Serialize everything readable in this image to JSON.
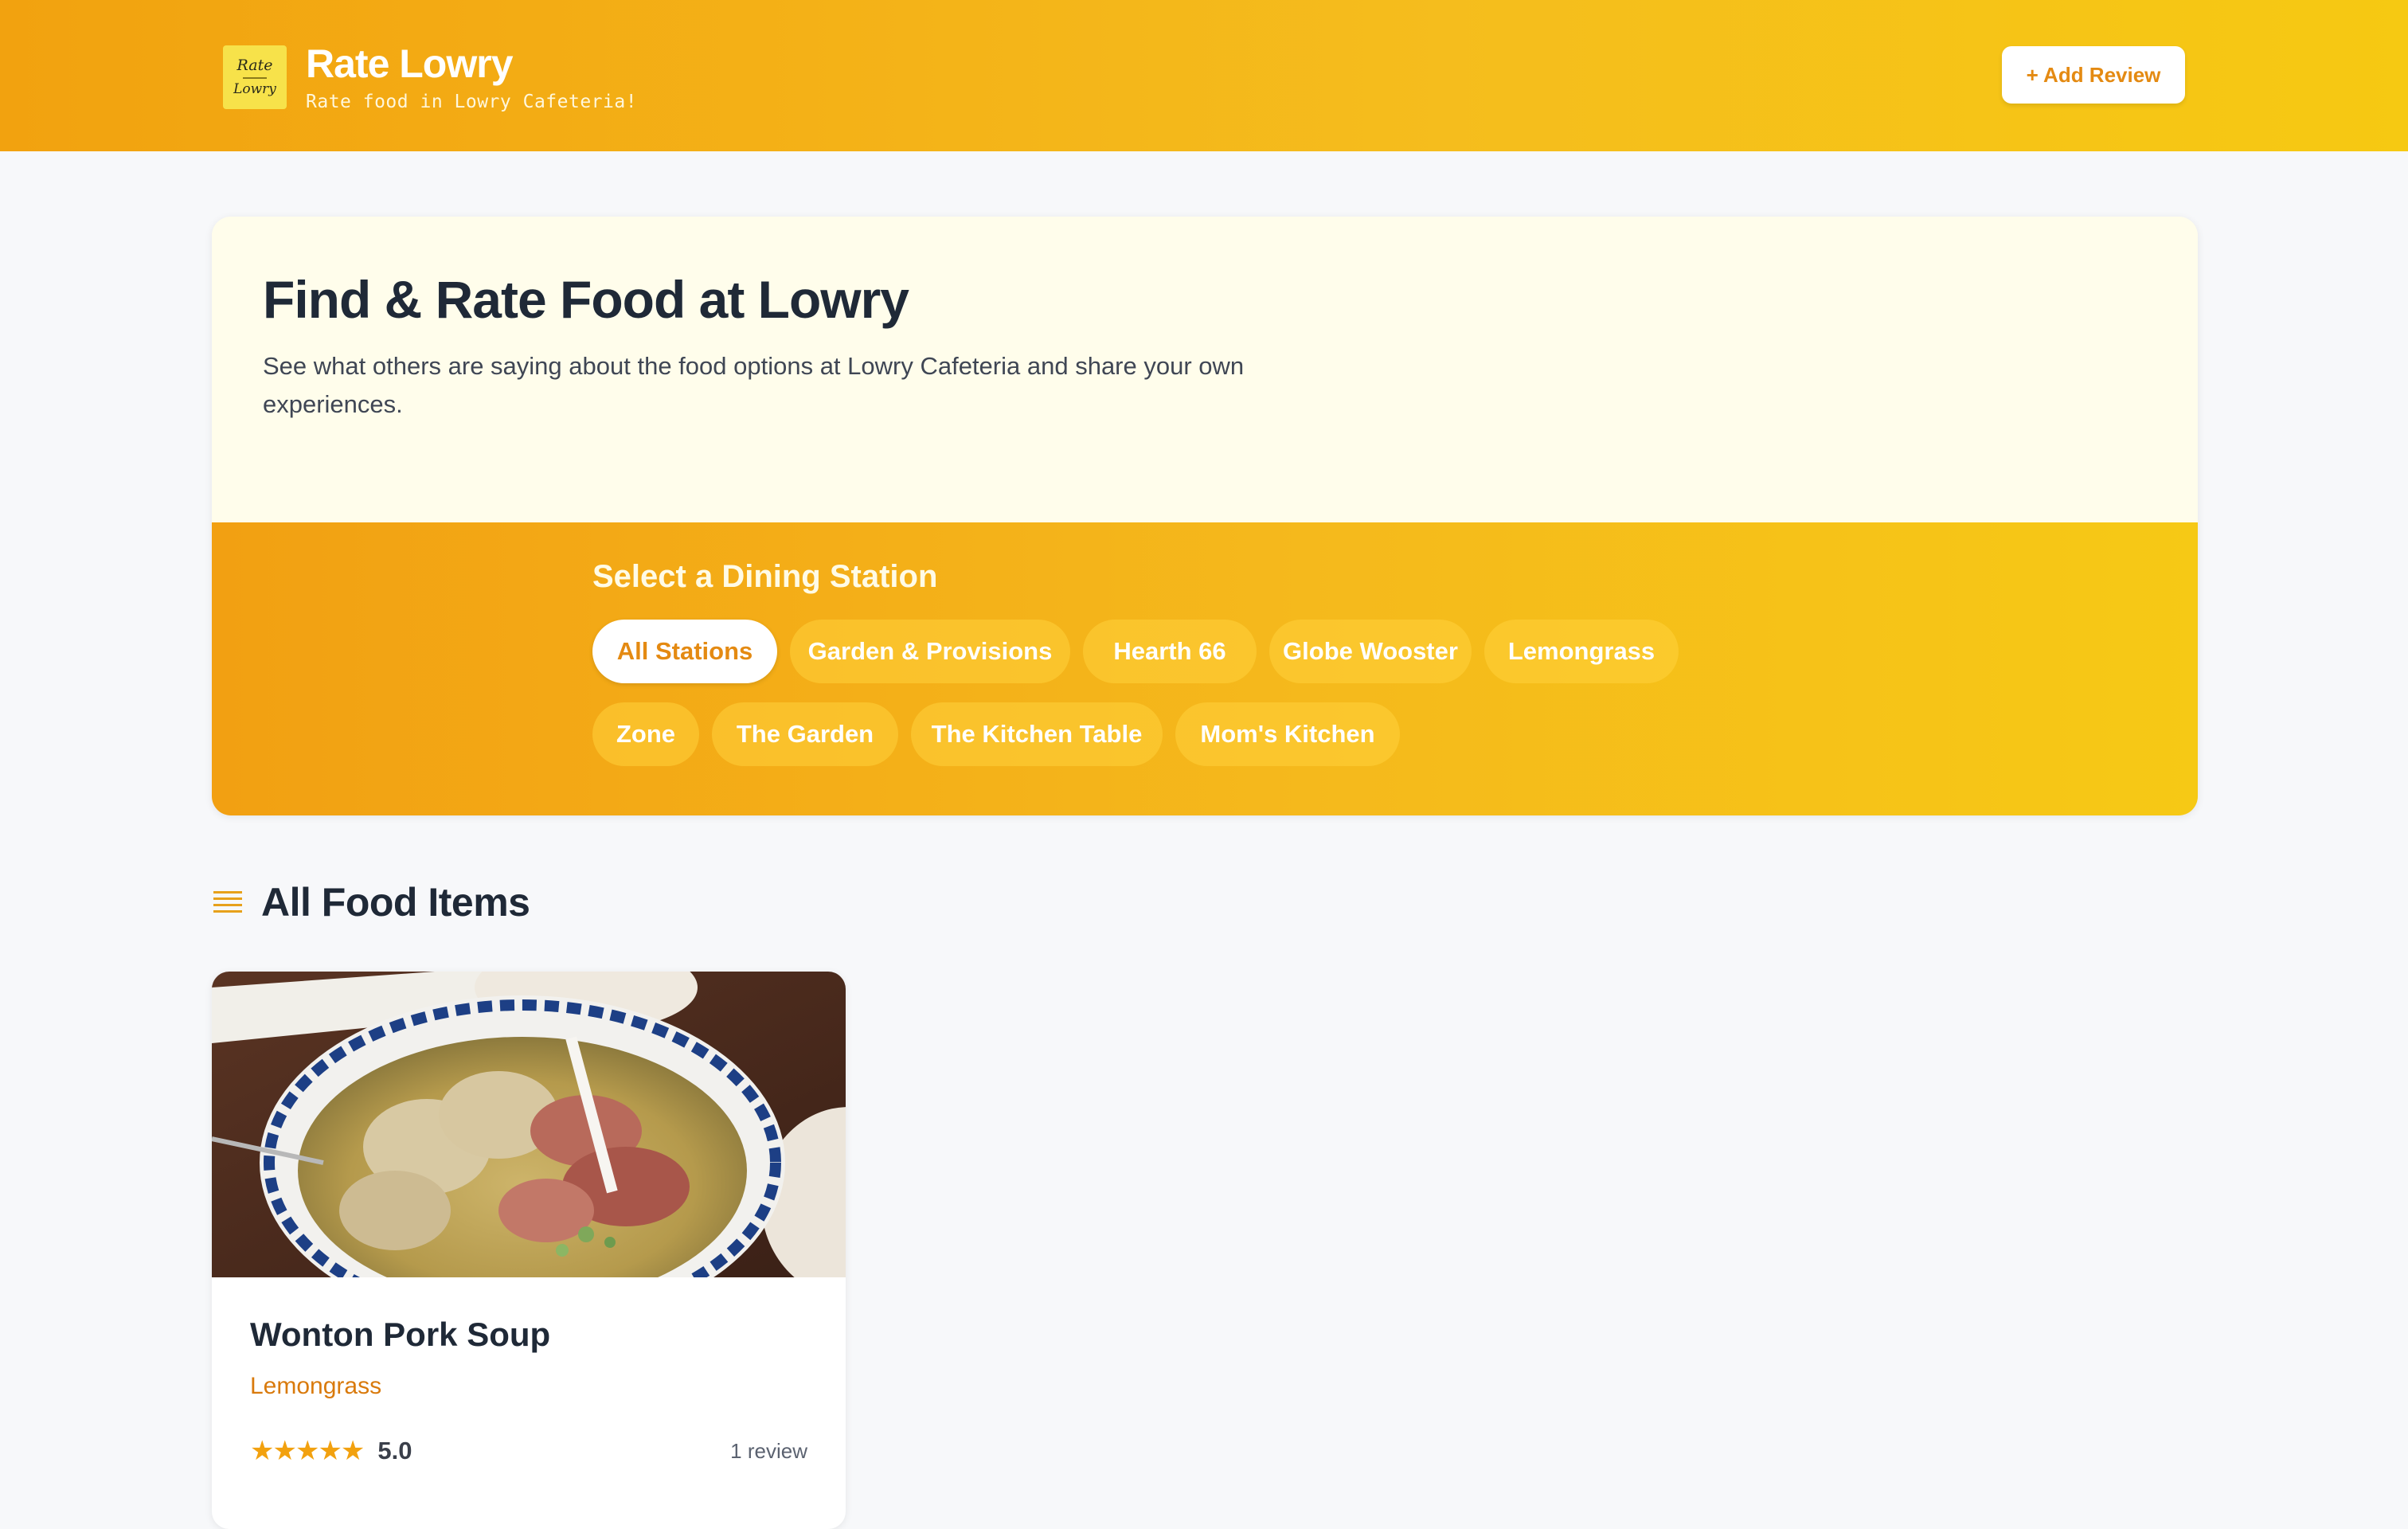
{
  "header": {
    "logo_text_top": "Rate",
    "logo_text_bottom": "Lowry",
    "title": "Rate Lowry",
    "subtitle": "Rate food in Lowry Cafeteria!",
    "add_review_label": "+ Add Review"
  },
  "hero": {
    "title": "Find & Rate Food at Lowry",
    "description": "See what others are saying about the food options at Lowry Cafeteria and share your own experiences.",
    "stations_heading": "Select a Dining Station",
    "stations": [
      {
        "label": "All Stations",
        "active": true
      },
      {
        "label": "Garden & Provisions",
        "active": false
      },
      {
        "label": "Hearth 66",
        "active": false
      },
      {
        "label": "Globe Wooster",
        "active": false
      },
      {
        "label": "Lemongrass",
        "active": false
      },
      {
        "label": "Zone",
        "active": false
      },
      {
        "label": "The Garden",
        "active": false
      },
      {
        "label": "The Kitchen Table",
        "active": false
      },
      {
        "label": "Mom's Kitchen",
        "active": false
      }
    ]
  },
  "section": {
    "icon": "list-icon",
    "title": "All Food Items"
  },
  "food_items": [
    {
      "name": "Wonton Pork Soup",
      "station": "Lemongrass",
      "stars_display": "★★★★★",
      "rating": "5.0",
      "reviews": "1 review"
    }
  ],
  "colors": {
    "accent": "#f2a20f",
    "accent_text": "#e48a12",
    "station_text": "#d97a0c",
    "hero_bg": "#fffdeb",
    "page_bg": "#f7f8fa"
  }
}
